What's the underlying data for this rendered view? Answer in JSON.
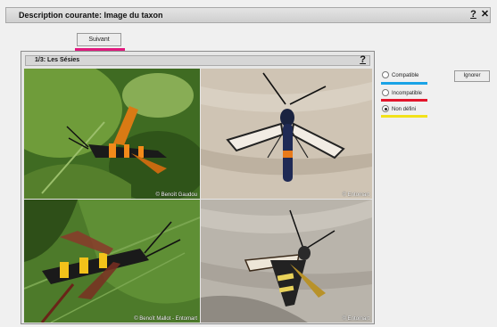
{
  "window": {
    "title": "Description courante: Image du taxon",
    "help_label": "?",
    "close_label": "✕"
  },
  "next_button": {
    "label": "Suivant",
    "underline_color": "#e0197e"
  },
  "panel": {
    "title": "1/3: Les Sésies",
    "help_label": "?",
    "photos": [
      {
        "credit": "© Benoît Gaudou"
      },
      {
        "credit": "© Entomart"
      },
      {
        "credit": "© Benoît Mallot - Entomart"
      },
      {
        "credit": "© Entomart"
      }
    ]
  },
  "options": [
    {
      "label": "Compatible",
      "checked": false,
      "color": "#1aa3e6"
    },
    {
      "label": "Incompatible",
      "checked": false,
      "color": "#e3152b"
    },
    {
      "label": "Non défini",
      "checked": true,
      "color": "#f2e21a"
    }
  ],
  "ignore_button": {
    "label": "Ignorer"
  }
}
